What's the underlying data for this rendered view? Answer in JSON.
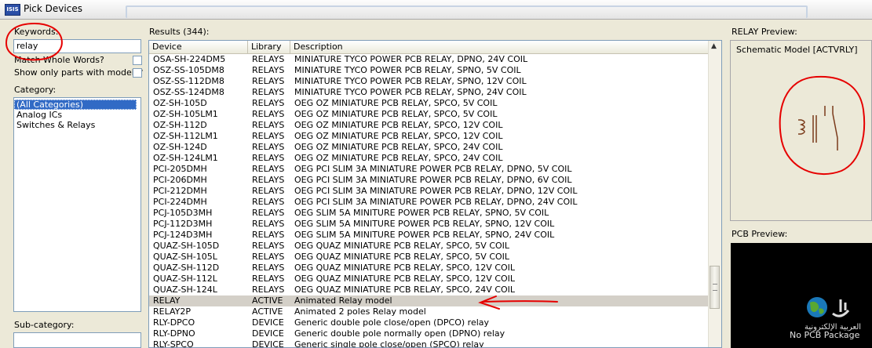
{
  "window": {
    "title": "Pick Devices",
    "icon": "ISIS"
  },
  "left_panel": {
    "keywords_label": "Keywords:",
    "keywords_value": "relay",
    "match_whole_words_label": "Match Whole Words?",
    "show_only_models_label": "Show only parts with models?",
    "category_label": "Category:",
    "categories": [
      "(All Categories)",
      "Analog ICs",
      "Switches & Relays"
    ],
    "selected_category": "(All Categories)",
    "subcategory_label": "Sub-category:"
  },
  "results": {
    "label": "Results (344):",
    "columns": [
      "Device",
      "Library",
      "Description"
    ],
    "rows": [
      [
        "OSA-SH-224DM5",
        "RELAYS",
        "MINIATURE TYCO POWER PCB RELAY, DPNO, 24V COIL"
      ],
      [
        "OSZ-SS-105DM8",
        "RELAYS",
        "MINIATURE TYCO POWER PCB RELAY, SPNO, 5V COIL"
      ],
      [
        "OSZ-SS-112DM8",
        "RELAYS",
        "MINIATURE TYCO POWER PCB RELAY, SPNO, 12V COIL"
      ],
      [
        "OSZ-SS-124DM8",
        "RELAYS",
        "MINIATURE TYCO POWER PCB RELAY, SPNO, 24V COIL"
      ],
      [
        "OZ-SH-105D",
        "RELAYS",
        "OEG OZ MINIATURE PCB RELAY, SPCO, 5V COIL"
      ],
      [
        "OZ-SH-105LM1",
        "RELAYS",
        "OEG OZ MINIATURE PCB RELAY, SPCO, 5V COIL"
      ],
      [
        "OZ-SH-112D",
        "RELAYS",
        "OEG OZ MINIATURE PCB RELAY, SPCO, 12V COIL"
      ],
      [
        "OZ-SH-112LM1",
        "RELAYS",
        "OEG OZ MINIATURE PCB RELAY, SPCO, 12V COIL"
      ],
      [
        "OZ-SH-124D",
        "RELAYS",
        "OEG OZ MINIATURE PCB RELAY, SPCO, 24V COIL"
      ],
      [
        "OZ-SH-124LM1",
        "RELAYS",
        "OEG OZ MINIATURE PCB RELAY, SPCO, 24V COIL"
      ],
      [
        "PCI-205DMH",
        "RELAYS",
        "OEG PCI SLIM 3A MINIATURE POWER PCB RELAY, DPNO, 5V COIL"
      ],
      [
        "PCI-206DMH",
        "RELAYS",
        "OEG PCI SLIM 3A MINIATURE POWER PCB RELAY, DPNO, 6V COIL"
      ],
      [
        "PCI-212DMH",
        "RELAYS",
        "OEG PCI SLIM 3A MINIATURE POWER PCB RELAY, DPNO, 12V COIL"
      ],
      [
        "PCI-224DMH",
        "RELAYS",
        "OEG PCI SLIM 3A MINIATURE POWER PCB RELAY, DPNO, 24V COIL"
      ],
      [
        "PCJ-105D3MH",
        "RELAYS",
        "OEG SLIM 5A MINITURE POWER PCB RELAY, SPNO, 5V COIL"
      ],
      [
        "PCJ-112D3MH",
        "RELAYS",
        "OEG SLIM 5A MINITURE POWER PCB RELAY, SPNO, 12V COIL"
      ],
      [
        "PCJ-124D3MH",
        "RELAYS",
        "OEG SLIM 5A MINITURE POWER PCB RELAY, SPNO, 24V COIL"
      ],
      [
        "QUAZ-SH-105D",
        "RELAYS",
        "OEG QUAZ MINIATURE PCB RELAY, SPCO, 5V COIL"
      ],
      [
        "QUAZ-SH-105L",
        "RELAYS",
        "OEG QUAZ MINIATURE PCB RELAY, SPCO, 5V COIL"
      ],
      [
        "QUAZ-SH-112D",
        "RELAYS",
        "OEG QUAZ MINIATURE PCB RELAY, SPCO, 12V COIL"
      ],
      [
        "QUAZ-SH-112L",
        "RELAYS",
        "OEG QUAZ MINIATURE PCB RELAY, SPCO, 12V COIL"
      ],
      [
        "QUAZ-SH-124L",
        "RELAYS",
        "OEG QUAZ MINIATURE PCB RELAY, SPCO, 24V COIL"
      ],
      [
        "RELAY",
        "ACTIVE",
        "Animated Relay model"
      ],
      [
        "RELAY2P",
        "ACTIVE",
        "Animated 2 poles Relay model"
      ],
      [
        "RLY-DPCO",
        "DEVICE",
        "Generic double pole close/open (DPCO) relay"
      ],
      [
        "RLY-DPNO",
        "DEVICE",
        "Generic double pole normally open (DPNO) relay"
      ],
      [
        "RLY-SPCO",
        "DEVICE",
        "Generic single pole close/open (SPCO) relay"
      ]
    ],
    "highlighted_row": 22
  },
  "preview": {
    "title": "RELAY Preview:",
    "model_text": "Schematic Model [ACTVRLY]",
    "pcb_title": "PCB Preview:",
    "pcb_text": "No PCB Package"
  },
  "colors": {
    "annotation": "#e60000",
    "selection": "#316ac5",
    "dialog_bg": "#ece9d8"
  }
}
